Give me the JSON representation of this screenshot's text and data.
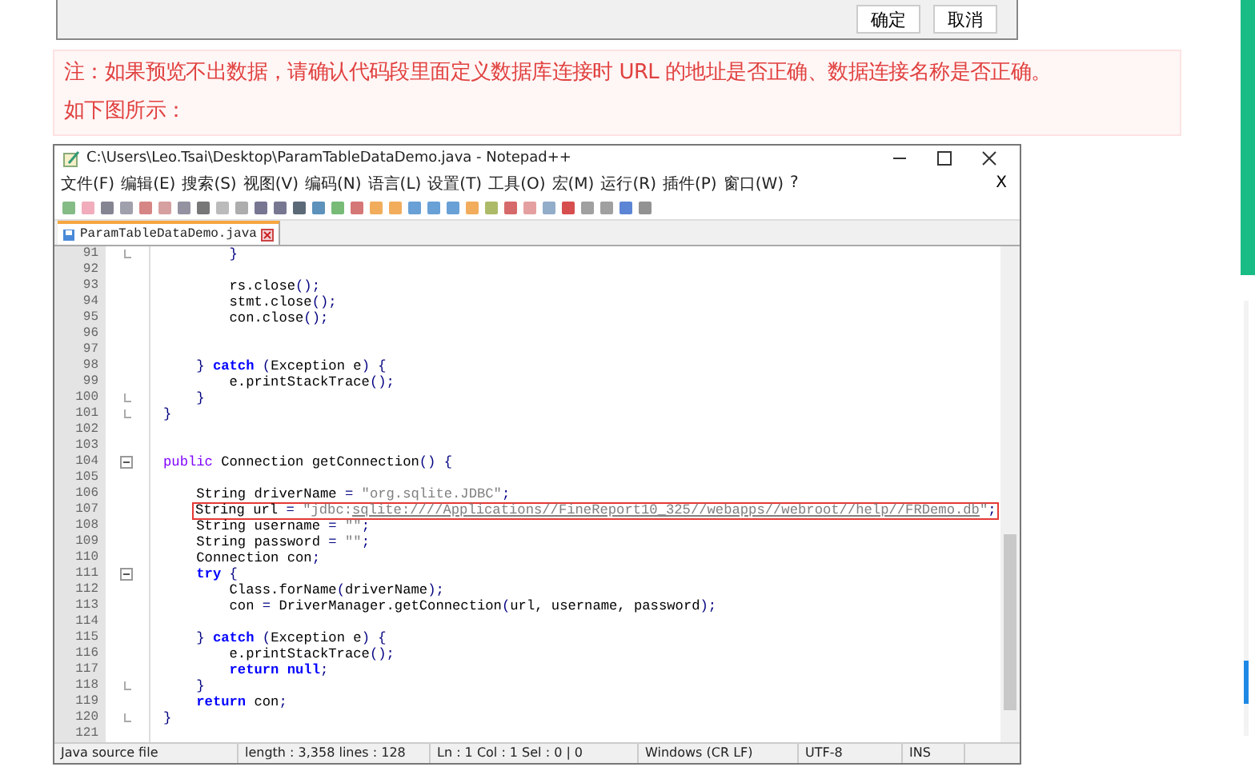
{
  "dialog": {
    "buttons": [
      "确定",
      "取消"
    ]
  },
  "note": {
    "lines": [
      "注：如果预览不出数据，请确认代码段里面定义数据库连接时 URL 的地址是否正确、数据连接名称是否正确。",
      "如下图所示："
    ]
  },
  "editor_window": {
    "title": "C:\\Users\\Leo.Tsai\\Desktop\\ParamTableDataDemo.java - Notepad++",
    "menu": [
      "文件(F)",
      "编辑(E)",
      "搜索(S)",
      "视图(V)",
      "编码(N)",
      "语言(L)",
      "设置(T)",
      "工具(O)",
      "宏(M)",
      "运行(R)",
      "插件(P)",
      "窗口(W)",
      "?"
    ],
    "menu_close": "X",
    "tabs": [
      {
        "label": "ParamTableDataDemo.java",
        "selected": true
      }
    ],
    "lines": [
      {
        "number": "91",
        "block_end": true,
        "tokens": [
          {
            "kind": "op",
            "text": "        }"
          }
        ]
      },
      {
        "number": "92"
      },
      {
        "number": "93",
        "tokens": [
          {
            "kind": "plain",
            "text": "        rs.close"
          },
          {
            "kind": "op",
            "text": "();"
          }
        ]
      },
      {
        "number": "94",
        "tokens": [
          {
            "kind": "plain",
            "text": "        stmt.close"
          },
          {
            "kind": "op",
            "text": "();"
          }
        ]
      },
      {
        "number": "95",
        "tokens": [
          {
            "kind": "plain",
            "text": "        con.close"
          },
          {
            "kind": "op",
            "text": "();"
          }
        ]
      },
      {
        "number": "96"
      },
      {
        "number": "97"
      },
      {
        "number": "98",
        "tokens": [
          {
            "kind": "op",
            "text": "    }"
          },
          {
            "kind": "keyword",
            "text": " catch "
          },
          {
            "kind": "op",
            "text": "("
          },
          {
            "kind": "plain",
            "text": "Exception e"
          },
          {
            "kind": "op",
            "text": ") {"
          }
        ]
      },
      {
        "number": "99",
        "tokens": [
          {
            "kind": "plain",
            "text": "        e.printStackTrace"
          },
          {
            "kind": "op",
            "text": "();"
          }
        ]
      },
      {
        "number": "100",
        "block_end": true,
        "tokens": [
          {
            "kind": "op",
            "text": "    }"
          }
        ]
      },
      {
        "number": "101",
        "block_end": true,
        "tokens": [
          {
            "kind": "op",
            "text": "}"
          }
        ]
      },
      {
        "number": "102"
      },
      {
        "number": "103"
      },
      {
        "number": "104",
        "foldable": true,
        "tokens": [
          {
            "kind": "modifier",
            "text": "public"
          },
          {
            "kind": "plain",
            "text": " Connection getConnection"
          },
          {
            "kind": "op",
            "text": "() {"
          }
        ]
      },
      {
        "number": "105"
      },
      {
        "number": "106",
        "tokens": [
          {
            "kind": "plain",
            "text": "    String driverName "
          },
          {
            "kind": "op",
            "text": "="
          },
          {
            "kind": "string",
            "text": " \"org.sqlite.JDBC\""
          },
          {
            "kind": "op",
            "text": ";"
          }
        ]
      },
      {
        "number": "107",
        "boxed": true,
        "tokens": [
          {
            "kind": "plain",
            "text": "String url "
          },
          {
            "kind": "op",
            "text": "="
          },
          {
            "kind": "string",
            "text": " \"jdbc:"
          },
          {
            "kind": "link",
            "text": "sqlite:////Applications//FineReport10_325//webapps//webroot//help//FRDemo.db"
          },
          {
            "kind": "string",
            "text": "\""
          },
          {
            "kind": "op",
            "text": ";"
          }
        ]
      },
      {
        "number": "108",
        "tokens": [
          {
            "kind": "plain",
            "text": "    String username "
          },
          {
            "kind": "op",
            "text": "="
          },
          {
            "kind": "string",
            "text": " \"\""
          },
          {
            "kind": "op",
            "text": ";"
          }
        ]
      },
      {
        "number": "109",
        "tokens": [
          {
            "kind": "plain",
            "text": "    String password "
          },
          {
            "kind": "op",
            "text": "="
          },
          {
            "kind": "string",
            "text": " \"\""
          },
          {
            "kind": "op",
            "text": ";"
          }
        ]
      },
      {
        "number": "110",
        "tokens": [
          {
            "kind": "plain",
            "text": "    Connection con"
          },
          {
            "kind": "op",
            "text": ";"
          }
        ]
      },
      {
        "number": "111",
        "foldable": true,
        "tokens": [
          {
            "kind": "keyword",
            "text": "    try"
          },
          {
            "kind": "op",
            "text": " {"
          }
        ]
      },
      {
        "number": "112",
        "tokens": [
          {
            "kind": "plain",
            "text": "        Class.forName"
          },
          {
            "kind": "op",
            "text": "("
          },
          {
            "kind": "plain",
            "text": "driverName"
          },
          {
            "kind": "op",
            "text": ");"
          }
        ]
      },
      {
        "number": "113",
        "tokens": [
          {
            "kind": "plain",
            "text": "        con "
          },
          {
            "kind": "op",
            "text": "="
          },
          {
            "kind": "plain",
            "text": " DriverManager.getConnection"
          },
          {
            "kind": "op",
            "text": "("
          },
          {
            "kind": "plain",
            "text": "url, username, password"
          },
          {
            "kind": "op",
            "text": ");"
          }
        ]
      },
      {
        "number": "114"
      },
      {
        "number": "115",
        "tokens": [
          {
            "kind": "op",
            "text": "    }"
          },
          {
            "kind": "keyword",
            "text": " catch "
          },
          {
            "kind": "op",
            "text": "("
          },
          {
            "kind": "plain",
            "text": "Exception e"
          },
          {
            "kind": "op",
            "text": ") {"
          }
        ]
      },
      {
        "number": "116",
        "tokens": [
          {
            "kind": "plain",
            "text": "        e.printStackTrace"
          },
          {
            "kind": "op",
            "text": "();"
          }
        ]
      },
      {
        "number": "117",
        "tokens": [
          {
            "kind": "keyword",
            "text": "        return null"
          },
          {
            "kind": "op",
            "text": ";"
          }
        ]
      },
      {
        "number": "118",
        "block_end": true,
        "tokens": [
          {
            "kind": "op",
            "text": "    }"
          }
        ]
      },
      {
        "number": "119",
        "tokens": [
          {
            "kind": "keyword",
            "text": "    return"
          },
          {
            "kind": "plain",
            "text": " con"
          },
          {
            "kind": "op",
            "text": ";"
          }
        ]
      },
      {
        "number": "120",
        "block_end": true,
        "tokens": [
          {
            "kind": "op",
            "text": "}"
          }
        ]
      },
      {
        "number": "121"
      }
    ],
    "status_bar": [
      "Java source file",
      "length : 3,358    lines : 128",
      "Ln : 1    Col : 1    Sel : 0 | 0",
      "Windows (CR LF)",
      "UTF-8",
      "INS"
    ]
  }
}
